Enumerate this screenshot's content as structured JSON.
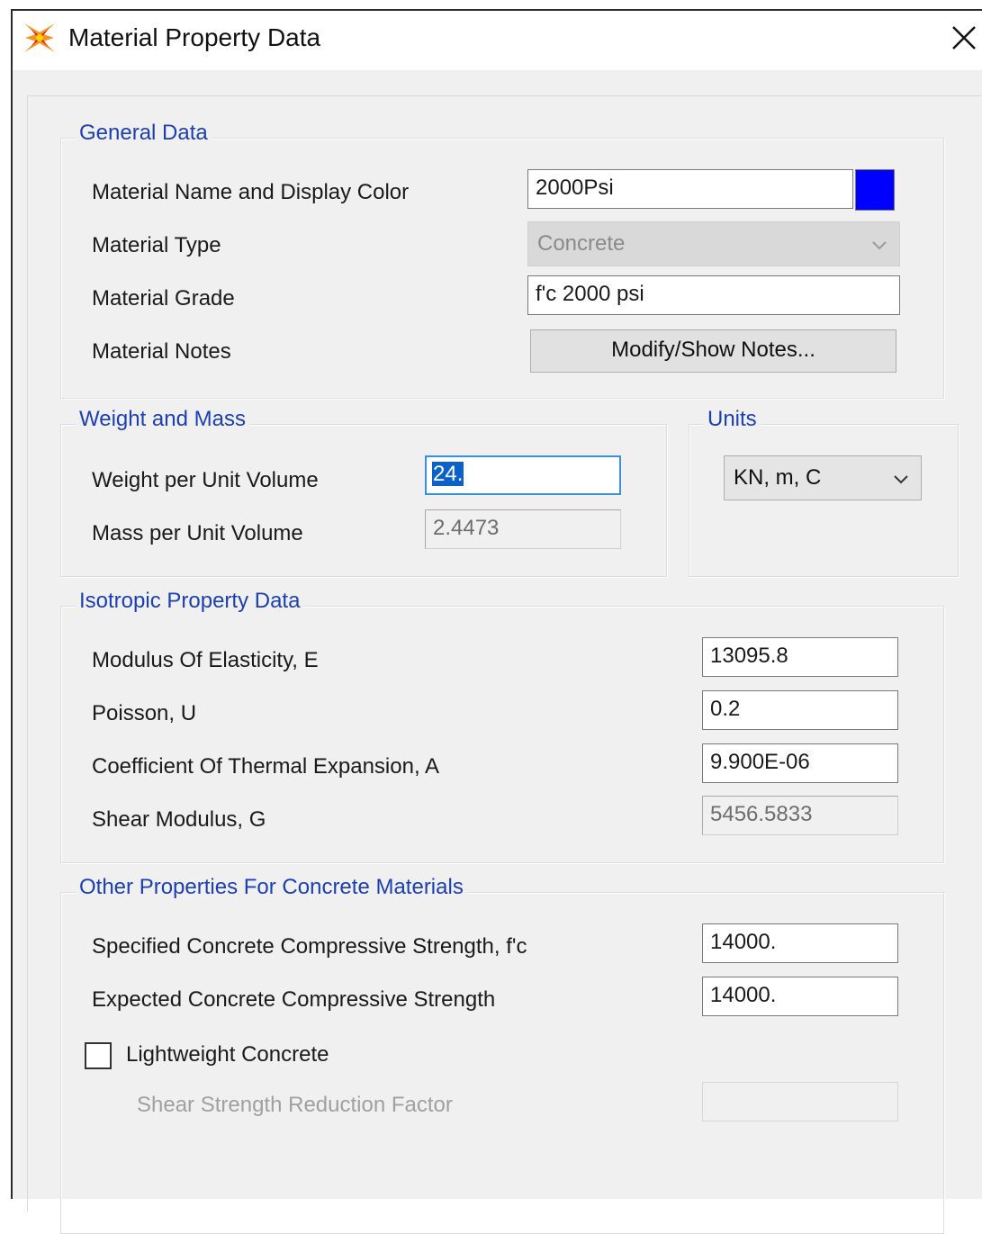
{
  "window": {
    "title": "Material Property Data"
  },
  "general": {
    "title": "General Data",
    "name_label": "Material Name and Display Color",
    "name_value": "2000Psi",
    "display_color": "#0000ff",
    "type_label": "Material Type",
    "type_value": "Concrete",
    "grade_label": "Material Grade",
    "grade_value": "f'c 2000 psi",
    "notes_label": "Material Notes",
    "notes_button": "Modify/Show Notes..."
  },
  "weight": {
    "title": "Weight and Mass",
    "weight_label": "Weight per Unit Volume",
    "weight_value": "24.",
    "mass_label": "Mass per Unit Volume",
    "mass_value": "2.4473"
  },
  "units": {
    "title": "Units",
    "value": "KN, m, C"
  },
  "isotropic": {
    "title": "Isotropic Property Data",
    "e_label": "Modulus Of Elasticity,  E",
    "e_value": "13095.8",
    "u_label": "Poisson, U",
    "u_value": "0.2",
    "a_label": "Coefficient Of Thermal Expansion,  A",
    "a_value": "9.900E-06",
    "g_label": "Shear Modulus,  G",
    "g_value": "5456.5833"
  },
  "concrete": {
    "title": "Other Properties For Concrete Materials",
    "fc_label": "Specified Concrete Compressive Strength, f'c",
    "fc_value": "14000.",
    "exp_label": "Expected Concrete Compressive Strength",
    "exp_value": "14000.",
    "lightweight_label": "Lightweight Concrete",
    "lightweight_checked": false,
    "shear_factor_label": "Shear Strength Reduction Factor",
    "shear_factor_value": ""
  }
}
